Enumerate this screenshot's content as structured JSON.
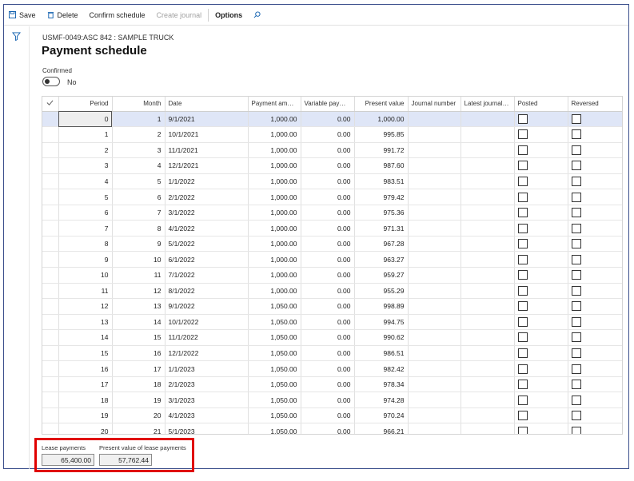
{
  "toolbar": {
    "save": "Save",
    "delete": "Delete",
    "confirm_schedule": "Confirm schedule",
    "create_journal": "Create journal",
    "options": "Options"
  },
  "breadcrumb": "USMF-0049:ASC 842 : SAMPLE TRUCK",
  "title": "Payment schedule",
  "confirmed": {
    "label": "Confirmed",
    "value": "No"
  },
  "grid": {
    "columns": [
      "Period",
      "Month",
      "Date",
      "Payment amount",
      "Variable payment",
      "Present value",
      "Journal number",
      "Latest journal n...",
      "Posted",
      "Reversed"
    ],
    "rows": [
      {
        "period": "0",
        "month": "1",
        "date": "9/1/2021",
        "payment": "1,000.00",
        "variable": "0.00",
        "pv": "1,000.00"
      },
      {
        "period": "1",
        "month": "2",
        "date": "10/1/2021",
        "payment": "1,000.00",
        "variable": "0.00",
        "pv": "995.85"
      },
      {
        "period": "2",
        "month": "3",
        "date": "11/1/2021",
        "payment": "1,000.00",
        "variable": "0.00",
        "pv": "991.72"
      },
      {
        "period": "3",
        "month": "4",
        "date": "12/1/2021",
        "payment": "1,000.00",
        "variable": "0.00",
        "pv": "987.60"
      },
      {
        "period": "4",
        "month": "5",
        "date": "1/1/2022",
        "payment": "1,000.00",
        "variable": "0.00",
        "pv": "983.51"
      },
      {
        "period": "5",
        "month": "6",
        "date": "2/1/2022",
        "payment": "1,000.00",
        "variable": "0.00",
        "pv": "979.42"
      },
      {
        "period": "6",
        "month": "7",
        "date": "3/1/2022",
        "payment": "1,000.00",
        "variable": "0.00",
        "pv": "975.36"
      },
      {
        "period": "7",
        "month": "8",
        "date": "4/1/2022",
        "payment": "1,000.00",
        "variable": "0.00",
        "pv": "971.31"
      },
      {
        "period": "8",
        "month": "9",
        "date": "5/1/2022",
        "payment": "1,000.00",
        "variable": "0.00",
        "pv": "967.28"
      },
      {
        "period": "9",
        "month": "10",
        "date": "6/1/2022",
        "payment": "1,000.00",
        "variable": "0.00",
        "pv": "963.27"
      },
      {
        "period": "10",
        "month": "11",
        "date": "7/1/2022",
        "payment": "1,000.00",
        "variable": "0.00",
        "pv": "959.27"
      },
      {
        "period": "11",
        "month": "12",
        "date": "8/1/2022",
        "payment": "1,000.00",
        "variable": "0.00",
        "pv": "955.29"
      },
      {
        "period": "12",
        "month": "13",
        "date": "9/1/2022",
        "payment": "1,050.00",
        "variable": "0.00",
        "pv": "998.89"
      },
      {
        "period": "13",
        "month": "14",
        "date": "10/1/2022",
        "payment": "1,050.00",
        "variable": "0.00",
        "pv": "994.75"
      },
      {
        "period": "14",
        "month": "15",
        "date": "11/1/2022",
        "payment": "1,050.00",
        "variable": "0.00",
        "pv": "990.62"
      },
      {
        "period": "15",
        "month": "16",
        "date": "12/1/2022",
        "payment": "1,050.00",
        "variable": "0.00",
        "pv": "986.51"
      },
      {
        "period": "16",
        "month": "17",
        "date": "1/1/2023",
        "payment": "1,050.00",
        "variable": "0.00",
        "pv": "982.42"
      },
      {
        "period": "17",
        "month": "18",
        "date": "2/1/2023",
        "payment": "1,050.00",
        "variable": "0.00",
        "pv": "978.34"
      },
      {
        "period": "18",
        "month": "19",
        "date": "3/1/2023",
        "payment": "1,050.00",
        "variable": "0.00",
        "pv": "974.28"
      },
      {
        "period": "19",
        "month": "20",
        "date": "4/1/2023",
        "payment": "1,050.00",
        "variable": "0.00",
        "pv": "970.24"
      },
      {
        "period": "20",
        "month": "21",
        "date": "5/1/2023",
        "payment": "1,050.00",
        "variable": "0.00",
        "pv": "966.21"
      }
    ]
  },
  "totals": {
    "lease_payments_label": "Lease payments",
    "lease_payments_value": "65,400.00",
    "pv_label": "Present value of lease payments",
    "pv_value": "57,762.44"
  },
  "colors": {
    "accent": "#0078d4",
    "selected_row": "#dfe6f7",
    "highlight": "#e00000"
  }
}
